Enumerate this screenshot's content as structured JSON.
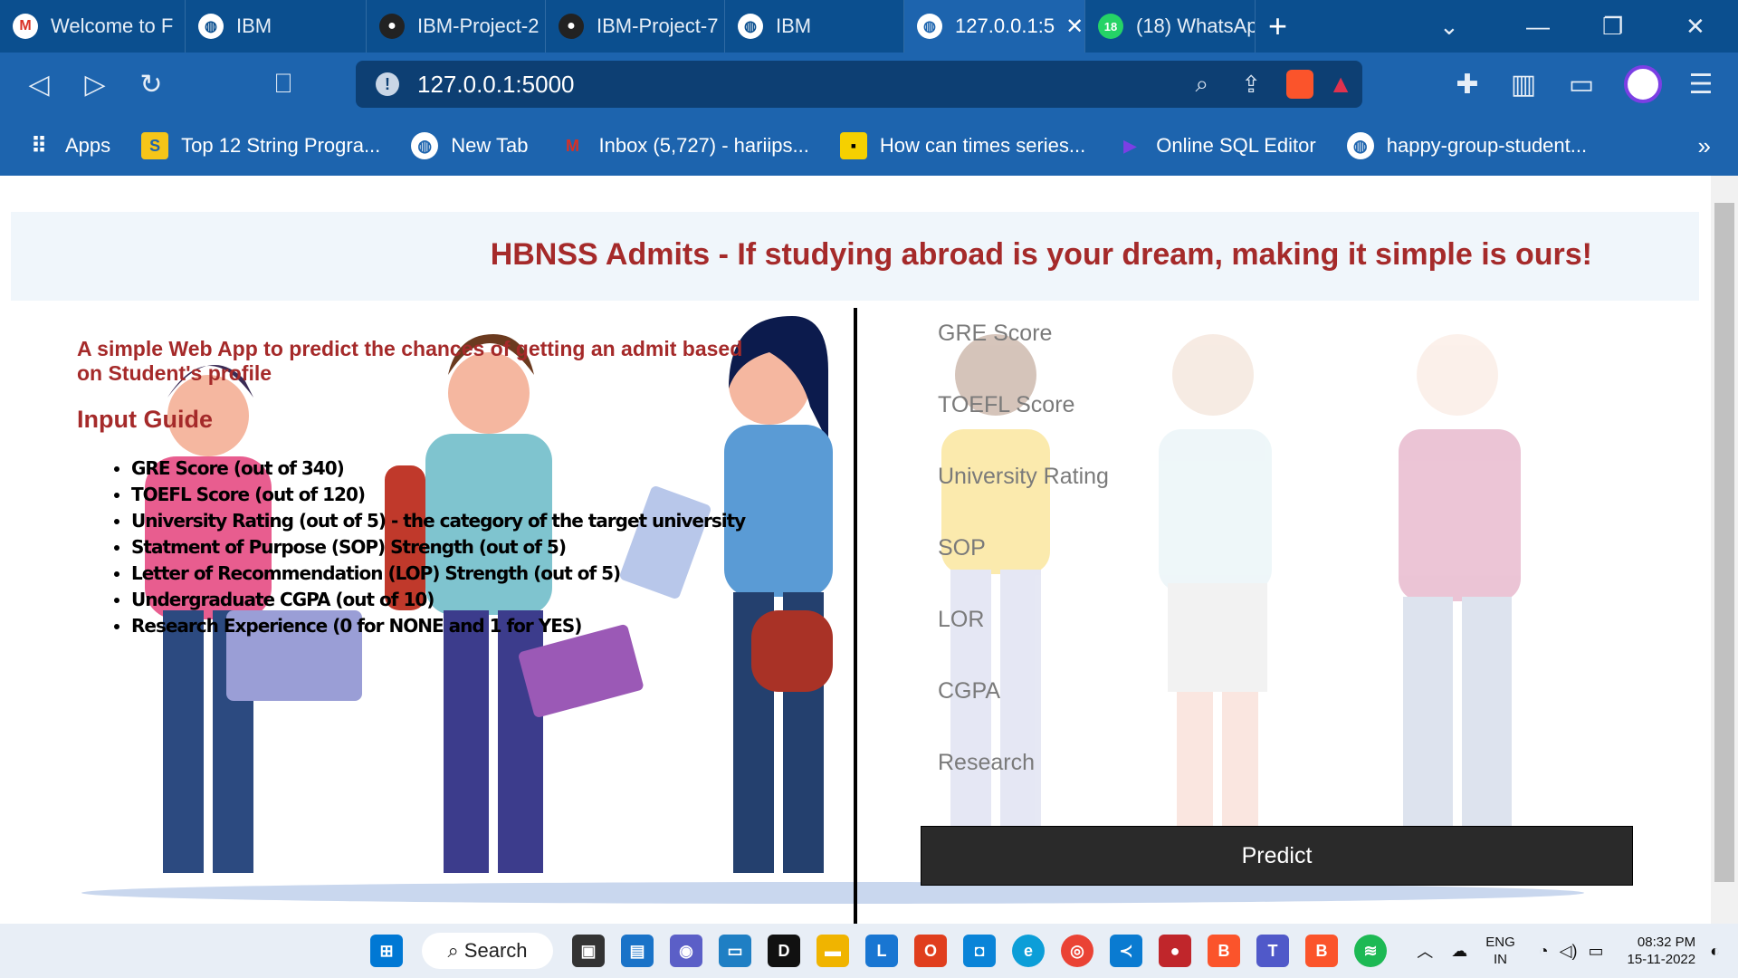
{
  "browser": {
    "tabs": [
      {
        "label": "Welcome to F",
        "icon": "gmail-icon"
      },
      {
        "label": "IBM",
        "icon": "globe-icon"
      },
      {
        "label": "IBM-Project-2",
        "icon": "github-icon"
      },
      {
        "label": "IBM-Project-7",
        "icon": "github-icon"
      },
      {
        "label": "IBM",
        "icon": "globe-icon"
      },
      {
        "label": "127.0.0.1:5",
        "icon": "globe-icon",
        "active": true
      },
      {
        "label": "(18) WhatsAp",
        "icon": "whatsapp-icon",
        "badge": "18"
      }
    ],
    "new_tab": "+",
    "url": "127.0.0.1:5000",
    "bookmarks": [
      {
        "label": "Apps",
        "icon": "apps-grid-icon"
      },
      {
        "label": "Top 12 String Progra...",
        "icon": "s-logo-icon"
      },
      {
        "label": "New Tab",
        "icon": "globe-icon"
      },
      {
        "label": "Inbox (5,727) - hariips...",
        "icon": "gmail-icon"
      },
      {
        "label": "How can times series...",
        "icon": "square-logo-icon"
      },
      {
        "label": "Online SQL Editor",
        "icon": "sql-logo-icon"
      },
      {
        "label": "happy-group-student...",
        "icon": "globe-icon"
      }
    ],
    "more": "»"
  },
  "page": {
    "heading": "HBNSS Admits - If studying abroad is your dream, making it simple is ours!",
    "intro": "A simple Web App to predict the chances of getting an admit based on Student's profile",
    "guide_title": "Input Guide",
    "guide_items": [
      "GRE Score (out of 340)",
      "TOEFL Score (out of 120)",
      "University Rating (out of 5) - the category of the target university",
      "Statment of Purpose (SOP) Strength (out of 5)",
      "Letter of Recommendation (LOP) Strength (out of 5)",
      "Undergraduate CGPA (out of 10)",
      "Research Experience (0 for NONE and 1 for YES)"
    ],
    "fields": [
      "GRE Score",
      "TOEFL Score",
      "University Rating",
      "SOP",
      "LOR",
      "CGPA",
      "Research"
    ],
    "predict_label": "Predict"
  },
  "taskbar": {
    "search_label": "Search",
    "lang_top": "ENG",
    "lang_bottom": "IN",
    "time": "08:32 PM",
    "date": "15-11-2022"
  },
  "colors": {
    "accent": "#a52a2a",
    "chrome": "#1d64ae"
  }
}
